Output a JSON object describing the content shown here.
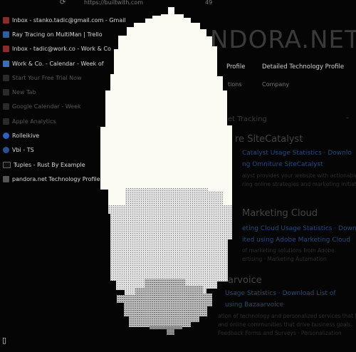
{
  "address": {
    "nav_arrows": "⟳",
    "url": "https://builtwith.com",
    "count": "49"
  },
  "menu": [
    {
      "label": "Inbox - stanko.tadic@gmail.com - Gmail",
      "icon": "gmail-icon",
      "faded": false
    },
    {
      "label": "Ray Tracing on MultiMan | Trello",
      "icon": "trello-icon",
      "faded": false
    },
    {
      "label": "Inbox - tadic@work.co - Work & Co",
      "icon": "gmail-icon",
      "faded": false
    },
    {
      "label": "Work & Co. - Calendar - Week of",
      "icon": "calendar-icon",
      "faded": false
    },
    {
      "label": "Start Your Free Trial Now",
      "icon": "page-icon",
      "faded": true
    },
    {
      "label": "New Tab",
      "icon": "page-icon",
      "faded": true
    },
    {
      "label": "Google Calendar - Week",
      "icon": "calendar-icon",
      "faded": true
    },
    {
      "label": "Apple Analytics",
      "icon": "page-icon",
      "faded": true
    },
    {
      "label": "Rolleikive",
      "icon": "rollei-icon",
      "faded": false
    },
    {
      "label": "Vbi - TS",
      "icon": "vb-icon",
      "faded": false
    },
    {
      "label": "Tuples - Rust By Example",
      "icon": "rust-icon",
      "faded": false
    },
    {
      "label": "pandora.net Technology Profile",
      "icon": "pandora-icon",
      "faded": false
    }
  ],
  "page": {
    "logo": "NDORA.NET",
    "tab_profile": "Profile",
    "tab_detailed": "Detailed Technology Profile",
    "sub_tools": "tions",
    "sub_company": "Company",
    "heading_tracking": "et Tracking",
    "collapse": "–",
    "s1_title": "re SiteCatalyst",
    "s1_link1": "Catalyst Usage Statistics · Downlo",
    "s1_link2": "ng Omniture SiteCatalyst",
    "s1_text1": "alyst provides your website with actionable",
    "s1_text2": "ring online strategies and marketing initiat",
    "s2_title": "Marketing Cloud",
    "s2_link1": "eting Cloud Usage Statistics · Downl",
    "s2_link2": "ited using Adobe Marketing Cloud",
    "s2_text1": "of marketing solutions from Adobe.",
    "s2_text2": "ertising · Marketing Automation",
    "s3_title": "arvoice",
    "s3_link1": "Usage Statistics · Download List of",
    "s3_link2": "using Bazaarvoice",
    "s3_text1": "ation of technology and personalized services that help",
    "s3_text2": "and online communities that drive business goals.",
    "s3_text3": "Feedback Forms and Surveys · Personalization"
  },
  "caret": "▯"
}
